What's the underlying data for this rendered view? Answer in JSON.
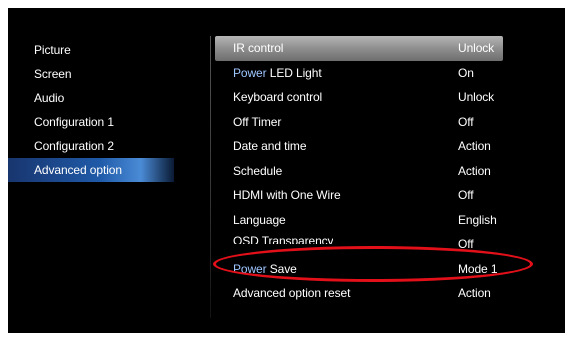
{
  "left_menu": {
    "items": [
      {
        "label": "Picture"
      },
      {
        "label": "Screen"
      },
      {
        "label": "Audio"
      },
      {
        "label": "Configuration 1"
      },
      {
        "label": "Configuration 2"
      },
      {
        "label": "Advanced option"
      }
    ],
    "active_index": 5
  },
  "right_menu": {
    "items": [
      {
        "label": "IR control",
        "value": "Unlock"
      },
      {
        "label_highlight": "Power",
        "label_rest": " LED Light",
        "value": "On"
      },
      {
        "label": "Keyboard control",
        "value": "Unlock"
      },
      {
        "label": "Off Timer",
        "value": "Off"
      },
      {
        "label": "Date and time",
        "value": "Action"
      },
      {
        "label": "Schedule",
        "value": "Action"
      },
      {
        "label": "HDMI with One Wire",
        "value": "Off"
      },
      {
        "label": "Language",
        "value": "English"
      },
      {
        "label": "OSD Transparency",
        "value": "Off"
      },
      {
        "label_highlight": "Power",
        "label_rest": " Save",
        "value": "Mode 1"
      },
      {
        "label": "Advanced option reset",
        "value": "Action"
      }
    ],
    "active_index": 0
  },
  "colors": {
    "background": "#000000",
    "text": "#ffffff",
    "highlight_text": "#9fc6ff",
    "left_active": "#1f5aa8",
    "right_active": "#8e8e8e",
    "annotation": "#e3101a"
  }
}
